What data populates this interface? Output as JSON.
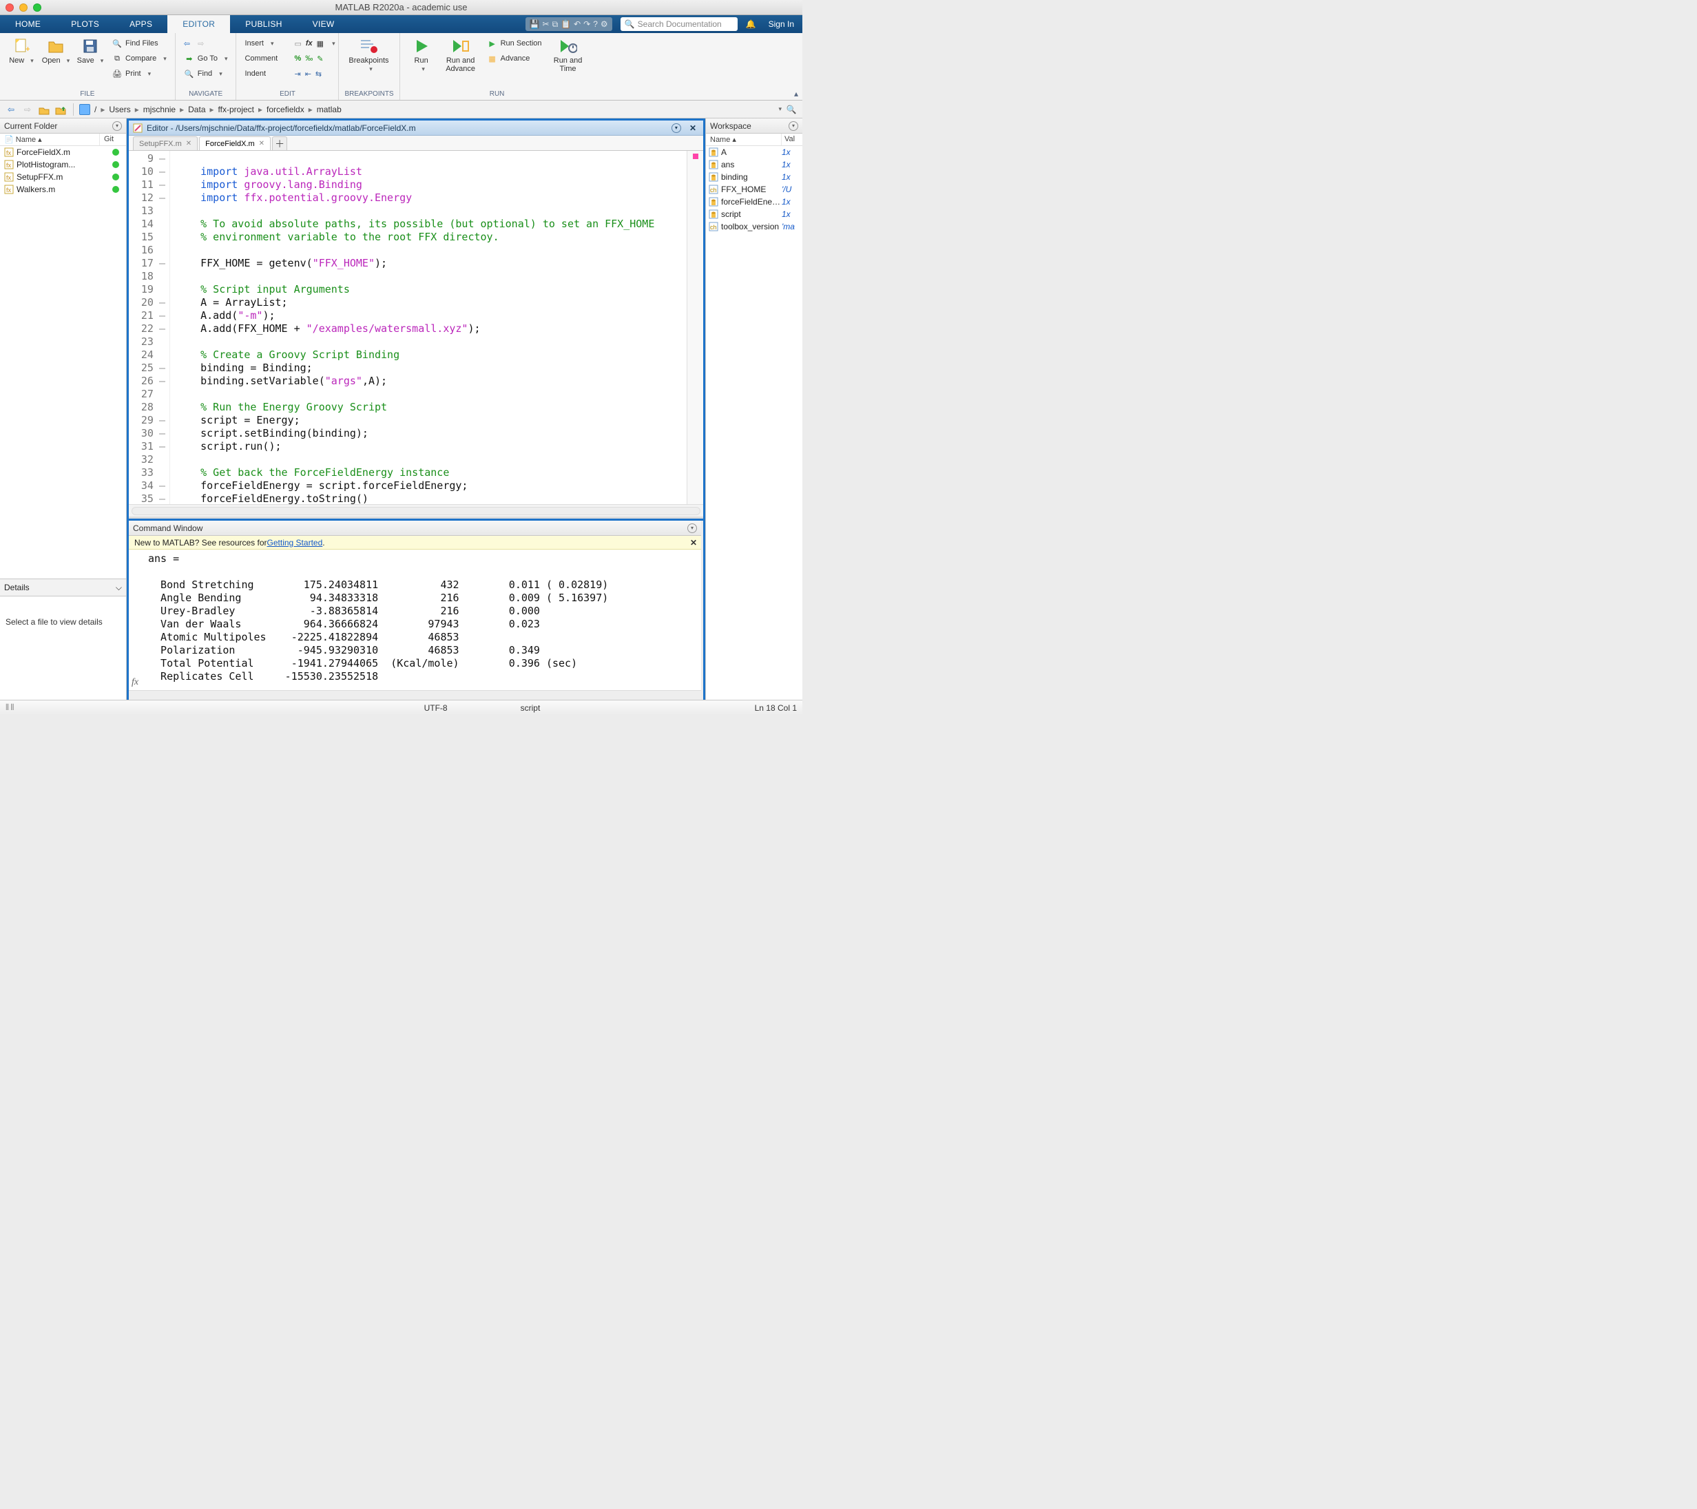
{
  "window": {
    "title": "MATLAB R2020a - academic use"
  },
  "tabs": {
    "items": [
      "HOME",
      "PLOTS",
      "APPS",
      "EDITOR",
      "PUBLISH",
      "VIEW"
    ],
    "signin": "Sign In"
  },
  "search": {
    "placeholder": "Search Documentation"
  },
  "toolstrip": {
    "file": {
      "label": "FILE",
      "new": "New",
      "open": "Open",
      "save": "Save",
      "findfiles": "Find Files",
      "compare": "Compare",
      "print": "Print"
    },
    "navigate": {
      "label": "NAVIGATE",
      "goto": "Go To",
      "find": "Find"
    },
    "edit": {
      "label": "EDIT",
      "insert": "Insert",
      "comment": "Comment",
      "indent": "Indent"
    },
    "breakpoints": {
      "label": "BREAKPOINTS",
      "btn": "Breakpoints"
    },
    "run": {
      "label": "RUN",
      "run": "Run",
      "runadvance": "Run and\nAdvance",
      "runsection": "Run Section",
      "advance": "Advance",
      "runtime": "Run and\nTime"
    }
  },
  "path": {
    "crumbs": [
      "/",
      "Users",
      "mjschnie",
      "Data",
      "ffx-project",
      "forcefieldx",
      "matlab"
    ]
  },
  "currentFolder": {
    "title": "Current Folder",
    "cols": {
      "name": "Name",
      "git": "Git"
    },
    "files": [
      {
        "name": "ForceFieldX.m"
      },
      {
        "name": "PlotHistogram..."
      },
      {
        "name": "SetupFFX.m"
      },
      {
        "name": "Walkers.m"
      }
    ],
    "details": "Details",
    "detailsMsg": "Select a file to view details"
  },
  "editor": {
    "title": "Editor - /Users/mjschnie/Data/ffx-project/forcefieldx/matlab/ForceFieldX.m",
    "tabs": [
      {
        "name": "SetupFFX.m",
        "active": false
      },
      {
        "name": "ForceFieldX.m",
        "active": true
      }
    ],
    "startLine": 9,
    "lines": [
      {
        "d": true,
        "seg": []
      },
      {
        "d": true,
        "seg": [
          [
            "    ",
            ""
          ],
          [
            "import ",
            "kw"
          ],
          [
            "java.util.ArrayList",
            "pk"
          ]
        ]
      },
      {
        "d": true,
        "seg": [
          [
            "    ",
            ""
          ],
          [
            "import ",
            "kw"
          ],
          [
            "groovy.lang.Binding",
            "pk"
          ]
        ]
      },
      {
        "d": true,
        "seg": [
          [
            "    ",
            ""
          ],
          [
            "import ",
            "kw"
          ],
          [
            "ffx.potential.groovy.Energy",
            "pk"
          ]
        ]
      },
      {
        "d": false,
        "seg": []
      },
      {
        "d": false,
        "seg": [
          [
            "    ",
            ""
          ],
          [
            "% To avoid absolute paths, its possible (but optional) to set an FFX_HOME",
            "cm"
          ]
        ]
      },
      {
        "d": false,
        "seg": [
          [
            "    ",
            ""
          ],
          [
            "% environment variable to the root FFX directoy.",
            "cm"
          ]
        ]
      },
      {
        "d": false,
        "seg": []
      },
      {
        "d": true,
        "seg": [
          [
            "    FFX_HOME = getenv(",
            ""
          ],
          [
            "\"FFX_HOME\"",
            "st"
          ],
          [
            ");",
            ""
          ]
        ]
      },
      {
        "d": false,
        "seg": []
      },
      {
        "d": false,
        "seg": [
          [
            "    ",
            ""
          ],
          [
            "% Script input Arguments",
            "cm"
          ]
        ]
      },
      {
        "d": true,
        "seg": [
          [
            "    A = ArrayList;",
            ""
          ]
        ]
      },
      {
        "d": true,
        "seg": [
          [
            "    A.add(",
            ""
          ],
          [
            "\"-m\"",
            "st"
          ],
          [
            ");",
            ""
          ]
        ]
      },
      {
        "d": true,
        "seg": [
          [
            "    A.add(FFX_HOME + ",
            ""
          ],
          [
            "\"/examples/watersmall.xyz\"",
            "st"
          ],
          [
            ");",
            ""
          ]
        ]
      },
      {
        "d": false,
        "seg": []
      },
      {
        "d": false,
        "seg": [
          [
            "    ",
            ""
          ],
          [
            "% Create a Groovy Script Binding",
            "cm"
          ]
        ]
      },
      {
        "d": true,
        "seg": [
          [
            "    binding = Binding;",
            ""
          ]
        ]
      },
      {
        "d": true,
        "seg": [
          [
            "    binding.setVariable(",
            ""
          ],
          [
            "\"args\"",
            "st"
          ],
          [
            ",A);",
            ""
          ]
        ]
      },
      {
        "d": false,
        "seg": []
      },
      {
        "d": false,
        "seg": [
          [
            "    ",
            ""
          ],
          [
            "% Run the Energy Groovy Script",
            "cm"
          ]
        ]
      },
      {
        "d": true,
        "seg": [
          [
            "    script = Energy;",
            ""
          ]
        ]
      },
      {
        "d": true,
        "seg": [
          [
            "    script.setBinding(binding);",
            ""
          ]
        ]
      },
      {
        "d": true,
        "seg": [
          [
            "    script.run();",
            ""
          ]
        ]
      },
      {
        "d": false,
        "seg": []
      },
      {
        "d": false,
        "seg": [
          [
            "    ",
            ""
          ],
          [
            "% Get back the ForceFieldEnergy instance",
            "cm"
          ]
        ]
      },
      {
        "d": true,
        "seg": [
          [
            "    forceFieldEnergy = script.forceFieldEnergy;",
            ""
          ]
        ]
      },
      {
        "d": true,
        "seg": [
          [
            "    forceFieldEnergy.toString()",
            ""
          ]
        ]
      }
    ]
  },
  "commandWindow": {
    "title": "Command Window",
    "getting_pre": "New to MATLAB? See resources for ",
    "getting_link": "Getting Started",
    "lines": [
      "ans =",
      "",
      "  Bond Stretching        175.24034811          432        0.011 ( 0.02819)",
      "  Angle Bending           94.34833318          216        0.009 ( 5.16397)",
      "  Urey-Bradley            -3.88365814          216        0.000",
      "  Van der Waals          964.36666824        97943        0.023",
      "  Atomic Multipoles    -2225.41822894        46853",
      "  Polarization          -945.93290310        46853        0.349",
      "  Total Potential      -1941.27944065  (Kcal/mole)        0.396 (sec)",
      "  Replicates Cell     -15530.23552518"
    ]
  },
  "workspace": {
    "title": "Workspace",
    "cols": {
      "name": "Name",
      "val": "Val"
    },
    "items": [
      {
        "name": "A",
        "val": "1x",
        "ic": "jar"
      },
      {
        "name": "ans",
        "val": "1x",
        "ic": "jar"
      },
      {
        "name": "binding",
        "val": "1x",
        "ic": "jar"
      },
      {
        "name": "FFX_HOME",
        "val": "'/U",
        "ic": "str"
      },
      {
        "name": "forceFieldEnergy",
        "val": "1x",
        "ic": "jar"
      },
      {
        "name": "script",
        "val": "1x",
        "ic": "jar"
      },
      {
        "name": "toolbox_version",
        "val": "'ma",
        "ic": "str"
      }
    ]
  },
  "status": {
    "enc": "UTF-8",
    "type": "script",
    "pos": "Ln  18   Col  1"
  }
}
